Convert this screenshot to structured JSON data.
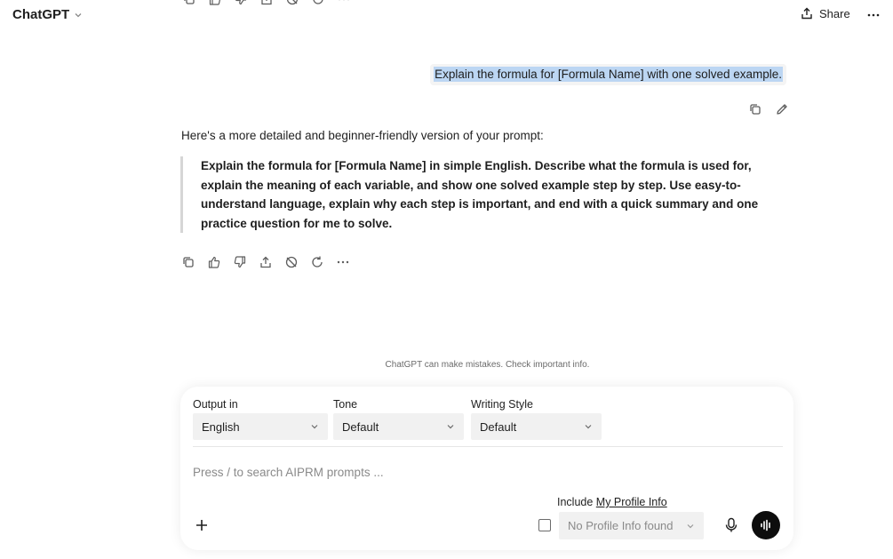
{
  "header": {
    "brand": "ChatGPT",
    "share_label": "Share"
  },
  "user_message": {
    "text": "Explain the formula for [Formula Name] with one solved example."
  },
  "assistant": {
    "intro": "Here's a more detailed and beginner-friendly version of your prompt:",
    "quote_lines": [
      "Explain the formula for [Formula Name] in simple English. Describe what the formula is used for,",
      "explain the meaning of each variable, and show one solved example step by step. Use easy-to-",
      "understand language, explain why each step is important, and end with a quick summary and one",
      "practice question for me to solve."
    ]
  },
  "disclaimer": "ChatGPT can make mistakes. Check important info.",
  "composer": {
    "output_label": "Output in",
    "output_value": "English",
    "tone_label": "Tone",
    "tone_value": "Default",
    "style_label": "Writing Style",
    "style_value": "Default",
    "placeholder": "Press / to search AIPRM prompts ...",
    "include_label": "Include",
    "include_link": "My Profile Info",
    "profile_value": "No Profile Info found"
  },
  "icons": {
    "top_actions": [
      "copy-icon",
      "thumbs-up-icon",
      "thumbs-down-icon",
      "share-icon",
      "hide-icon",
      "regenerate-icon",
      "more-icon"
    ],
    "user_actions": [
      "copy-icon",
      "edit-icon"
    ],
    "composer": [
      "plus-icon",
      "mic-icon",
      "voice-mode-icon"
    ]
  },
  "colors": {
    "selection": "#bcd6f3",
    "bubble": "#f4f4f4",
    "select_bg": "#f1f1f1",
    "voice_button": "#0d0d0d"
  }
}
